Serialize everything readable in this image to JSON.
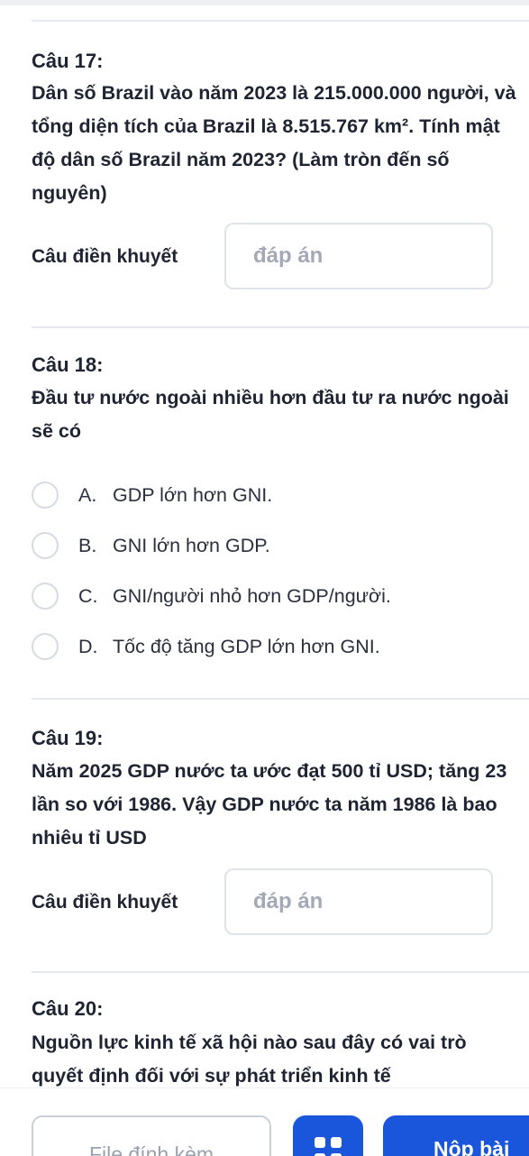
{
  "questions": [
    {
      "number": "Câu 17:",
      "text": "Dân số Brazil vào năm 2023 là 215.000.000 người, và tổng diện tích của Brazil là 8.515.767 km². Tính mật độ dân số Brazil năm 2023? (Làm tròn đến số nguyên)",
      "fill_label": "Câu điền khuyết",
      "placeholder": "đáp án",
      "value": ""
    },
    {
      "number": "Câu 18:",
      "text": "Đầu tư nước ngoài nhiều hơn đầu tư ra nước ngoài sẽ có",
      "options": [
        {
          "letter": "A.",
          "text": "GDP lớn hơn GNI."
        },
        {
          "letter": "B.",
          "text": "GNI lớn hơn GDP."
        },
        {
          "letter": "C.",
          "text": "GNI/người nhỏ hơn GDP/người."
        },
        {
          "letter": "D.",
          "text": "Tốc độ tăng GDP lớn hơn GNI."
        }
      ]
    },
    {
      "number": "Câu 19:",
      "text": "Năm 2025 GDP nước ta ước đạt 500 tỉ USD; tăng 23 lần so với 1986. Vậy GDP nước ta năm 1986 là bao nhiêu tỉ USD",
      "fill_label": "Câu điền khuyết",
      "placeholder": "đáp án",
      "value": ""
    },
    {
      "number": "Câu 20:",
      "text": "Nguồn lực kinh tế xã hội nào sau đây có vai trò quyết định đối với sự phát triển kinh tế"
    }
  ],
  "bottom_bar": {
    "attach_label": "File đính kèm",
    "grid_icon": "grid-icon",
    "submit_label": "Nộp bài"
  },
  "colors": {
    "accent": "#1a56db",
    "text": "#1f2433",
    "placeholder": "#a3a9b6",
    "divider": "#e6e9ef"
  }
}
